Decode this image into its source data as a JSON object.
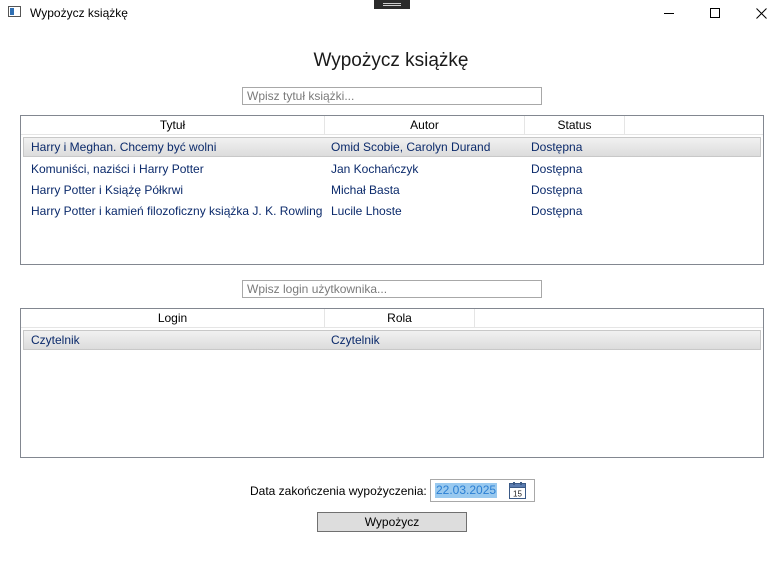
{
  "window": {
    "title": "Wypożycz książkę"
  },
  "heading": "Wypożycz książkę",
  "books": {
    "search_placeholder": "Wpisz tytuł książki...",
    "columns": {
      "title": "Tytuł",
      "author": "Autor",
      "status": "Status"
    },
    "rows": [
      {
        "title": "Harry i Meghan. Chcemy być wolni",
        "author": "Omid Scobie, Carolyn Durand",
        "status": "Dostępna"
      },
      {
        "title": "Komuniści, naziści i Harry Potter",
        "author": "Jan Kochańczyk",
        "status": "Dostępna"
      },
      {
        "title": "Harry Potter i Książę Półkrwi",
        "author": "Michał Basta",
        "status": "Dostępna"
      },
      {
        "title": "Harry Potter i kamień filozoficzny książka J. K. Rowling",
        "author": "Lucile Lhoste",
        "status": "Dostępna"
      }
    ],
    "selected_index": 0
  },
  "users": {
    "search_placeholder": "Wpisz login użytkownika...",
    "columns": {
      "login": "Login",
      "role": "Rola"
    },
    "rows": [
      {
        "login": "Czytelnik",
        "role": "Czytelnik"
      }
    ],
    "selected_index": 0
  },
  "loan": {
    "end_date_label": "Data zakończenia wypożyczenia:",
    "end_date_value": "22.03.2025",
    "calendar_day": "15",
    "submit_label": "Wypożycz"
  },
  "icons": {
    "app": "window-app-icon",
    "minimize": "minimize-icon",
    "maximize": "maximize-icon",
    "close": "close-icon",
    "calendar": "calendar-icon"
  }
}
